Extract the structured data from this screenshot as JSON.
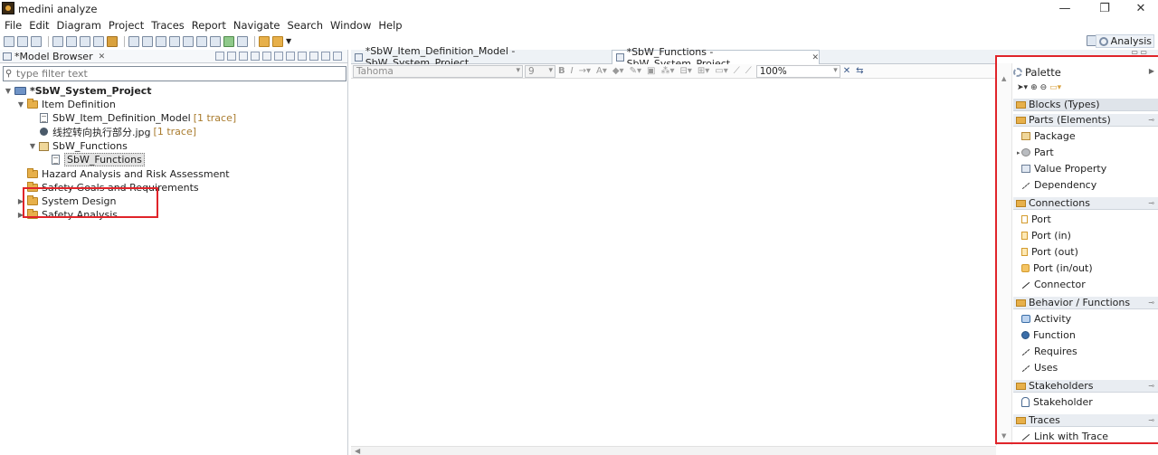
{
  "window": {
    "title": "medini analyze",
    "controls": [
      "—",
      "❐",
      "✕"
    ]
  },
  "menu": [
    "File",
    "Edit",
    "Diagram",
    "Project",
    "Traces",
    "Report",
    "Navigate",
    "Search",
    "Window",
    "Help"
  ],
  "toolbar": {
    "perspective_label": "Analysis"
  },
  "model_browser": {
    "tab_label": "*Model Browser",
    "filter_placeholder": "type filter text",
    "tree": {
      "project": "*SbW_System_Project",
      "item_definition": "Item Definition",
      "model": "SbW_Item_Definition_Model",
      "model_trace": "[1 trace]",
      "image": "线控转向执行部分.jpg",
      "image_trace": "[1 trace]",
      "functions_pkg": "SbW_Functions",
      "functions_diagram": "SbW_Functions",
      "hazard": "Hazard Analysis and Risk Assessment",
      "safety_goals": "Safety Goals and Requirements",
      "system_design": "System Design",
      "safety_analysis": "Safety Analysis"
    }
  },
  "editor": {
    "tabs": [
      {
        "label": "*SbW_Item_Definition_Model - SbW_System_Project"
      },
      {
        "label": "*SbW_Functions - SbW_System_Project"
      }
    ],
    "font_name": "Tahoma",
    "font_size": "9",
    "zoom": "100%"
  },
  "palette": {
    "title": "Palette",
    "drawers": {
      "blocks": "Blocks (Types)",
      "parts": "Parts (Elements)",
      "connections": "Connections",
      "behavior": "Behavior / Functions",
      "stakeholders": "Stakeholders",
      "traces": "Traces"
    },
    "items": {
      "package": "Package",
      "part": "Part",
      "value_property": "Value Property",
      "dependency": "Dependency",
      "port": "Port",
      "port_in": "Port (in)",
      "port_out": "Port (out)",
      "port_inout": "Port (in/out)",
      "connector": "Connector",
      "activity": "Activity",
      "function": "Function",
      "requires": "Requires",
      "uses": "Uses",
      "stakeholder": "Stakeholder",
      "link_with_trace": "Link with Trace"
    }
  },
  "colors": {
    "highlight_red": "#e0242a",
    "trace_text": "#a97b2d",
    "folder": "#e7b04a"
  }
}
